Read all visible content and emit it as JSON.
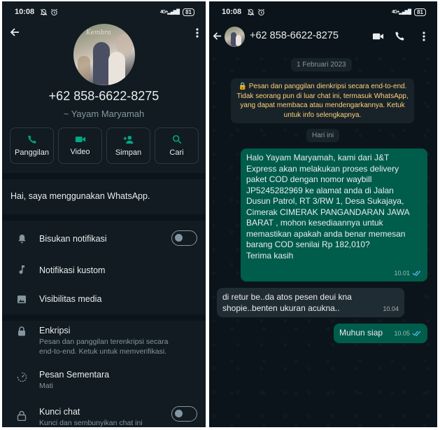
{
  "status_bar": {
    "time": "10:08",
    "network": "4G+",
    "battery": "81"
  },
  "profile": {
    "photo_text": "Kembra",
    "phone": "+62 858-6622-8275",
    "name": "~ Yayam Maryamah",
    "actions": [
      {
        "label": "Panggilan",
        "icon": "phone-icon"
      },
      {
        "label": "Video",
        "icon": "video-icon"
      },
      {
        "label": "Simpan",
        "icon": "add-person-icon"
      },
      {
        "label": "Cari",
        "icon": "search-icon"
      }
    ],
    "about": "Hai, saya menggunakan WhatsApp.",
    "settings": {
      "mute": {
        "title": "Bisukan notifikasi",
        "enabled": false
      },
      "custom_notif": {
        "title": "Notifikasi kustom"
      },
      "media_visibility": {
        "title": "Visibilitas media"
      },
      "encryption": {
        "title": "Enkripsi",
        "subtitle": "Pesan dan panggilan terenkripsi secara end-to-end. Ketuk untuk memverifikasi."
      },
      "disappearing": {
        "title": "Pesan Sementara",
        "subtitle": "Mati"
      },
      "chat_lock": {
        "title": "Kunci chat",
        "subtitle": "Kunci dan sembunyikan chat ini",
        "enabled": false
      }
    }
  },
  "chat": {
    "header_title": "+62 858-6622-8275",
    "date_pill_1": "1 Februari 2023",
    "encryption_notice": "🔒 Pesan dan panggilan dienkripsi secara end-to-end. Tidak seorang pun di luar chat ini, termasuk WhatsApp, yang dapat membaca atau mendengarkannya. Ketuk untuk info selengkapnya.",
    "date_pill_2": "Hari ini",
    "messages": [
      {
        "direction": "out",
        "text": "Halo Yayam Maryamah, kami dari J&T Express akan melakukan proses delivery paket COD dengan nomor waybill JP5245282969 ke alamat anda di Jalan Dusun Patrol, RT 3/RW 1, Desa Sukajaya, Cimerak CIMERAK PANGANDARAN JAWA BARAT , mohon kesediaannya untuk memastikan apakah anda benar memesan barang COD senilai Rp 182,010?\nTerima kasih",
        "time": "10.01",
        "status": "read"
      },
      {
        "direction": "in",
        "text": "di retur be..da atos pesen   deui kna shopie..benten ukuran acukna..",
        "time": "10.04"
      },
      {
        "direction": "out",
        "text": "Muhun siap",
        "time": "10.05",
        "status": "read"
      }
    ]
  },
  "colors": {
    "panel_bg": "#111b21",
    "chat_bg": "#0b141a",
    "outgoing_bubble": "#005c4b",
    "incoming_bubble": "#202c33",
    "accent": "#00a884",
    "read_ticks": "#53bdeb",
    "notice_text": "#ffd279"
  }
}
